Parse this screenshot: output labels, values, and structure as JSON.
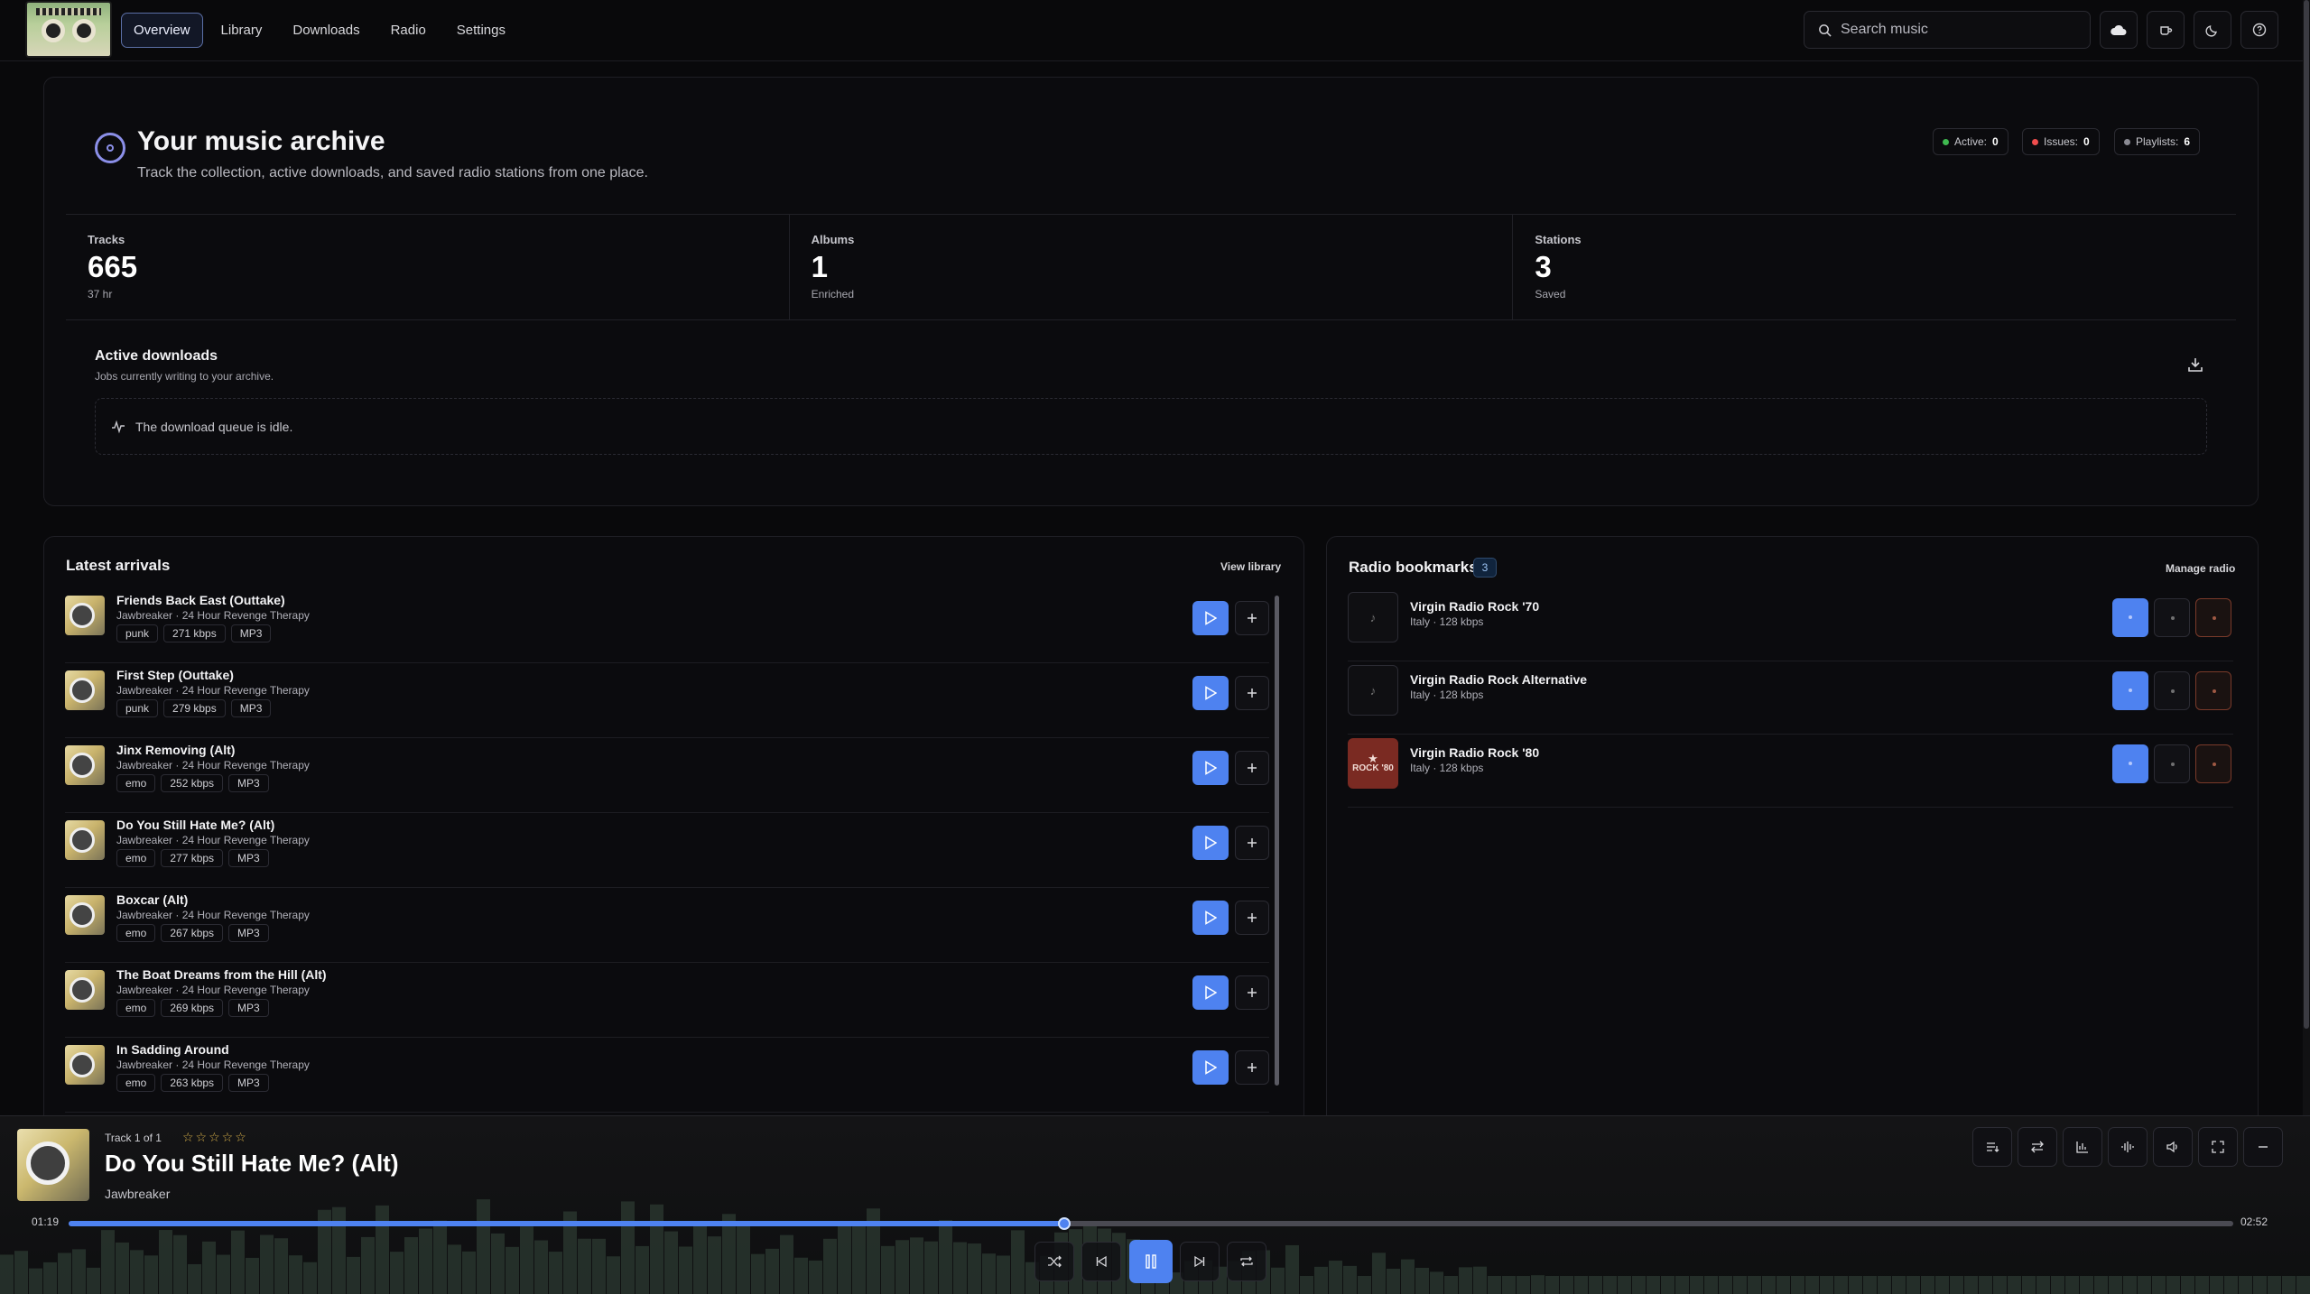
{
  "nav": {
    "tabs": [
      {
        "label": "Overview",
        "active": true
      },
      {
        "label": "Library"
      },
      {
        "label": "Downloads"
      },
      {
        "label": "Radio"
      },
      {
        "label": "Settings"
      }
    ],
    "search_placeholder": "Search music",
    "icons": [
      "cloud-icon",
      "cup-icon",
      "moon-icon",
      "help-icon"
    ]
  },
  "hero": {
    "title": "Your music archive",
    "subtitle": "Track the collection, active downloads, and saved radio stations from one place.",
    "chips": [
      {
        "label": "Active:",
        "value": "0",
        "color": "#3fb950"
      },
      {
        "label": "Issues:",
        "value": "0",
        "color": "#f04d4d"
      },
      {
        "label": "Playlists:",
        "value": "6",
        "color": "#8a8a93"
      }
    ]
  },
  "stats": [
    {
      "label": "Tracks",
      "value": "665",
      "sub": "37 hr"
    },
    {
      "label": "Albums",
      "value": "1",
      "sub": "Enriched"
    },
    {
      "label": "Stations",
      "value": "3",
      "sub": "Saved"
    }
  ],
  "downloads": {
    "title": "Active downloads",
    "subtitle": "Jobs currently writing to your archive.",
    "idle_text": "The download queue is idle."
  },
  "latest": {
    "title": "Latest arrivals",
    "link": "View library",
    "tracks": [
      {
        "title": "Friends Back East (Outtake)",
        "meta": "Jawbreaker · 24 Hour Revenge Therapy",
        "tags": [
          "punk",
          "271 kbps",
          "MP3"
        ]
      },
      {
        "title": "First Step (Outtake)",
        "meta": "Jawbreaker · 24 Hour Revenge Therapy",
        "tags": [
          "punk",
          "279 kbps",
          "MP3"
        ]
      },
      {
        "title": "Jinx Removing (Alt)",
        "meta": "Jawbreaker · 24 Hour Revenge Therapy",
        "tags": [
          "emo",
          "252 kbps",
          "MP3"
        ]
      },
      {
        "title": "Do You Still Hate Me? (Alt)",
        "meta": "Jawbreaker · 24 Hour Revenge Therapy",
        "tags": [
          "emo",
          "277 kbps",
          "MP3"
        ]
      },
      {
        "title": "Boxcar (Alt)",
        "meta": "Jawbreaker · 24 Hour Revenge Therapy",
        "tags": [
          "emo",
          "267 kbps",
          "MP3"
        ]
      },
      {
        "title": "The Boat Dreams from the Hill (Alt)",
        "meta": "Jawbreaker · 24 Hour Revenge Therapy",
        "tags": [
          "emo",
          "269 kbps",
          "MP3"
        ]
      },
      {
        "title": "In Sadding Around",
        "meta": "Jawbreaker · 24 Hour Revenge Therapy",
        "tags": [
          "emo",
          "263 kbps",
          "MP3"
        ]
      }
    ]
  },
  "radio": {
    "title": "Radio bookmarks",
    "count": "3",
    "link": "Manage radio",
    "stations": [
      {
        "name": "Virgin Radio Rock '70",
        "meta": "Italy · 128 kbps",
        "art": "♪"
      },
      {
        "name": "Virgin Radio Rock Alternative",
        "meta": "Italy · 128 kbps",
        "art": "♪"
      },
      {
        "name": "Virgin Radio Rock '80",
        "meta": "Italy · 128 kbps",
        "art": "ROCK '80"
      }
    ]
  },
  "player": {
    "track_count": "Track 1 of 1",
    "stars": "☆☆☆☆☆",
    "title": "Do You Still Hate Me? (Alt)",
    "artist": "Jawbreaker",
    "elapsed": "01:19",
    "duration": "02:52",
    "progress": 0.46,
    "accent": "#4e82f0"
  }
}
